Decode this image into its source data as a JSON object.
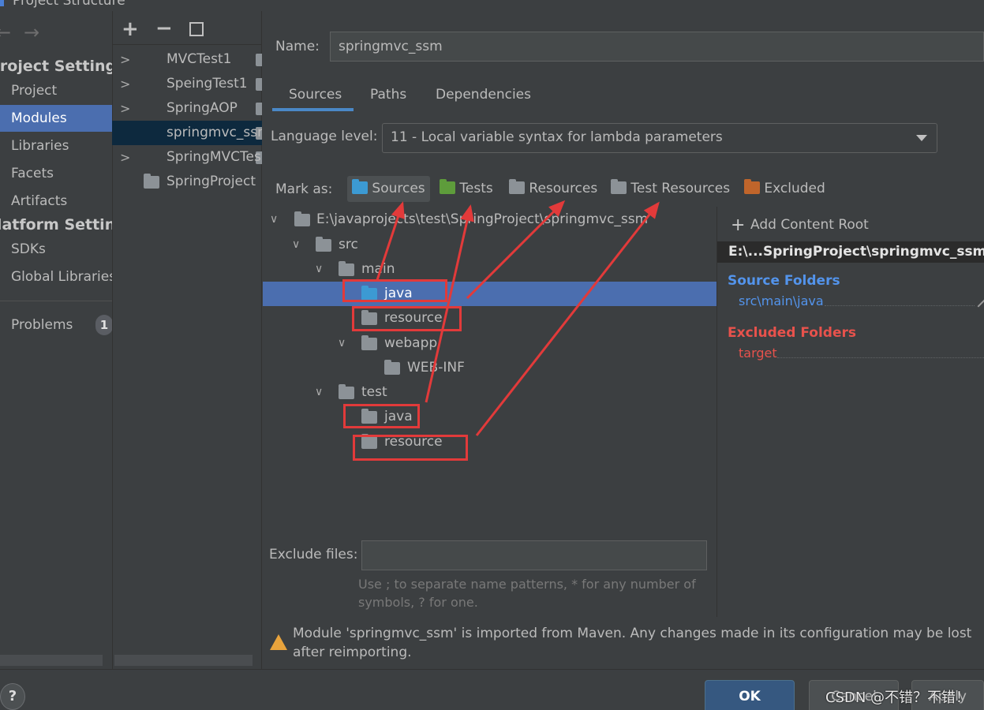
{
  "window": {
    "title": "Project Structure"
  },
  "nav": {
    "project_settings": "Project Settings",
    "project": "Project",
    "modules": "Modules",
    "libraries": "Libraries",
    "facets": "Facets",
    "artifacts": "Artifacts",
    "platform_settings": "Platform Settings",
    "sdks": "SDKs",
    "global_libraries": "Global Libraries",
    "problems": "Problems",
    "problems_count": "1"
  },
  "modules": {
    "items": [
      "MVCTest1",
      "SpeingTest1",
      "SpringAOP",
      "springmvc_ssm",
      "SpringMVCTes",
      "SpringProject"
    ]
  },
  "form": {
    "name_label": "Name:",
    "name_value": "springmvc_ssm",
    "tabs": [
      "Sources",
      "Paths",
      "Dependencies"
    ],
    "language_level_label": "Language level:",
    "language_level_value": "11 - Local variable syntax for lambda parameters",
    "mark_as_label": "Mark as:",
    "mark_buttons": [
      "Sources",
      "Tests",
      "Resources",
      "Test Resources",
      "Excluded"
    ]
  },
  "tree": {
    "root": "E:\\javaprojects\\test\\SpringProject\\springmvc_ssm",
    "src": "src",
    "main": "main",
    "main_java": "java",
    "main_resource": "resource",
    "webapp": "webapp",
    "webinf": "WEB-INF",
    "test": "test",
    "test_java": "java",
    "test_resource": "resource"
  },
  "content_root": {
    "add": "Add Content Root",
    "path": "E:\\...SpringProject\\springmvc_ssm",
    "source_folders_label": "Source Folders",
    "source_folder": "src\\main\\java",
    "excluded_label": "Excluded Folders",
    "excluded": "target"
  },
  "exclude": {
    "label": "Exclude files:",
    "value": "",
    "hint": "Use ; to separate name patterns, * for any number of symbols, ? for one."
  },
  "warning": "Module 'springmvc_ssm' is imported from Maven. Any changes made in its configuration may be lost after reimporting.",
  "footer": {
    "help": "?",
    "ok": "OK",
    "cancel": "Cancel",
    "apply": "Apply",
    "watermark": "CSDN @不错？不错！"
  }
}
